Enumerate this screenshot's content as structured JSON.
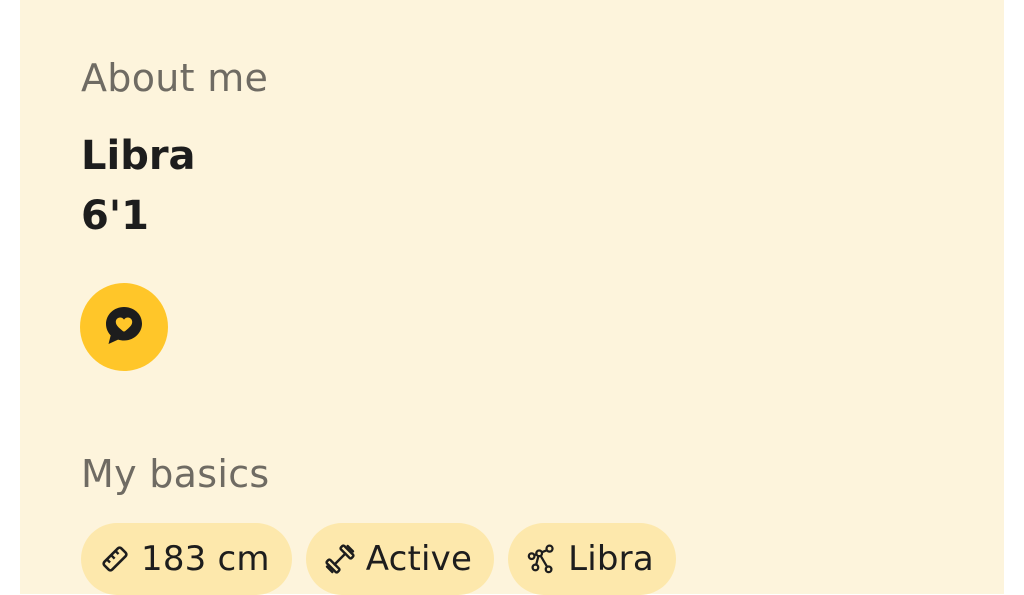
{
  "about": {
    "title": "About me",
    "bio_lines": [
      "Libra",
      "6'1"
    ]
  },
  "prompt_button": {
    "icon": "chat-heart-icon",
    "color": "#ffc629"
  },
  "basics": {
    "title": "My basics",
    "chips": [
      {
        "icon": "ruler-icon",
        "label": "183 cm"
      },
      {
        "icon": "dumbbell-icon",
        "label": "Active"
      },
      {
        "icon": "constellation-icon",
        "label": "Libra"
      }
    ]
  },
  "colors": {
    "card_background": "#fdf4dc",
    "chip_background": "#fde8ac",
    "accent": "#ffc629"
  }
}
